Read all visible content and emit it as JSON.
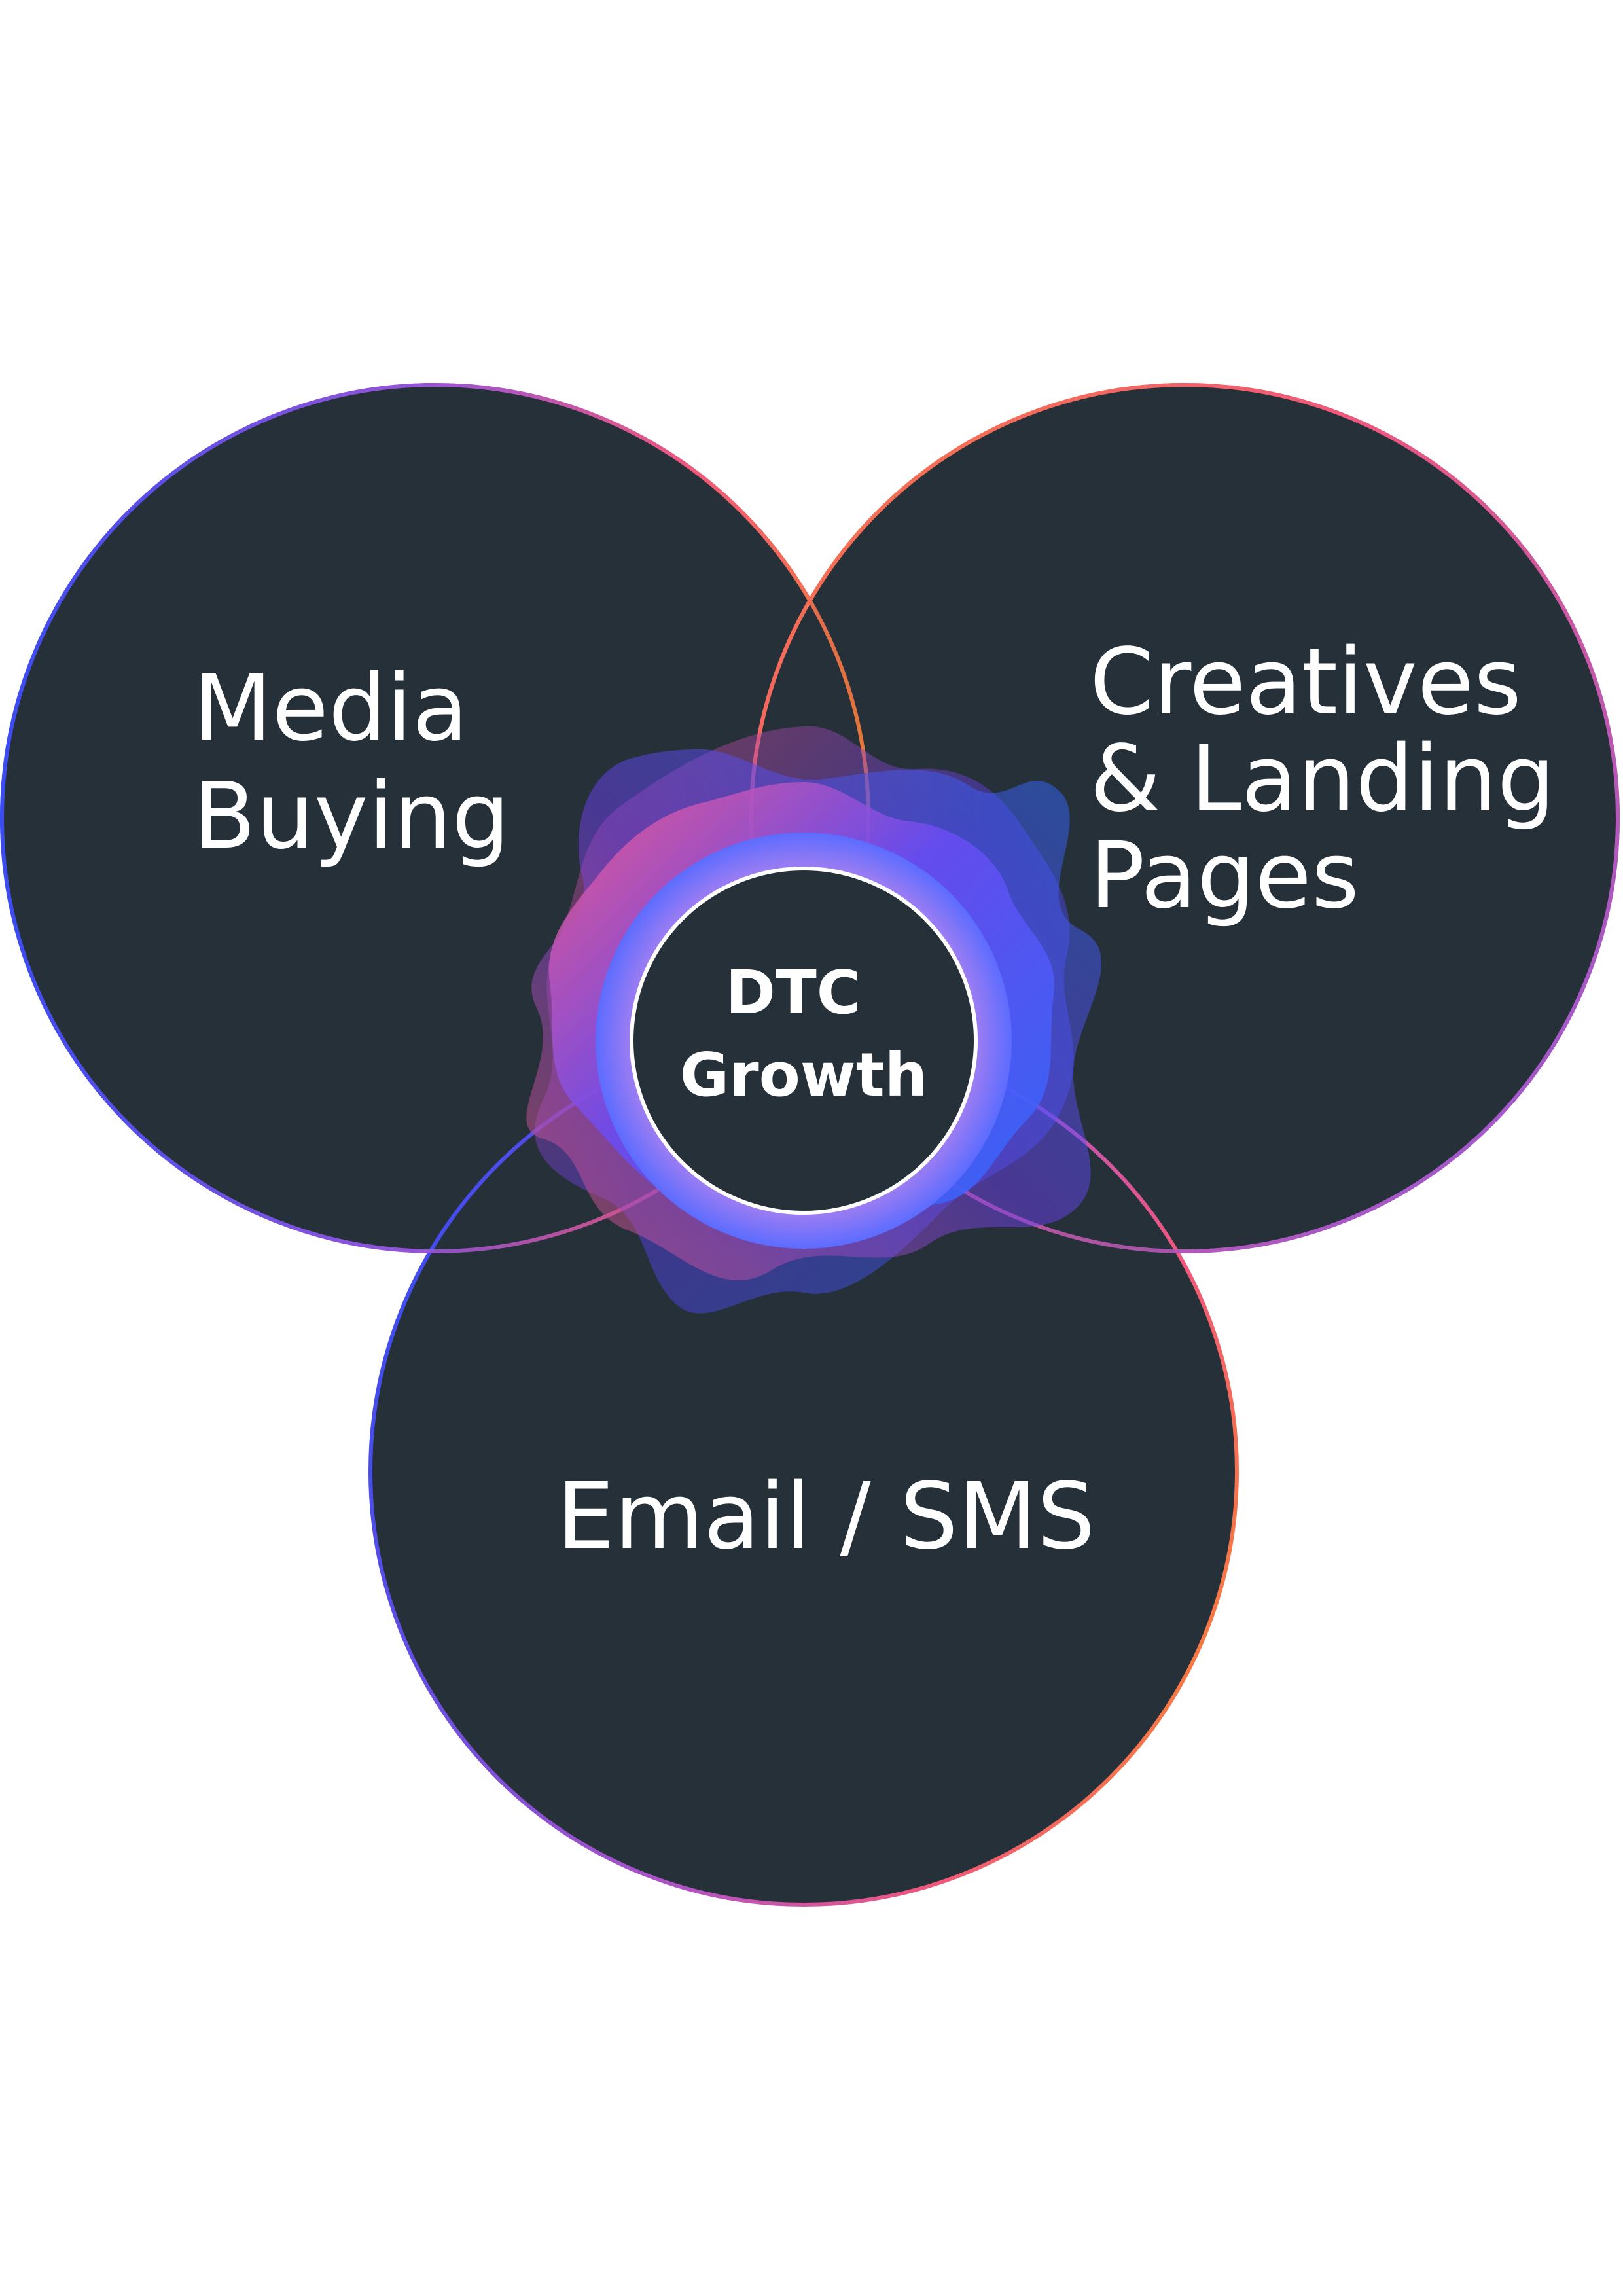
{
  "diagram": {
    "type": "venn",
    "sets": [
      {
        "id": "media",
        "lines": [
          "Media",
          "Buying"
        ]
      },
      {
        "id": "creatives",
        "lines": [
          "Creatives",
          "& Landing",
          "Pages"
        ]
      },
      {
        "id": "email",
        "lines": [
          "Email / SMS"
        ]
      }
    ],
    "center": {
      "lines": [
        "DTC",
        "Growth"
      ]
    },
    "colors": {
      "circle_fill": "#263038",
      "gradient_blue": "#3b4cf0",
      "gradient_purple": "#9a55d6",
      "gradient_pink": "#f0587a",
      "gradient_orange": "#f77f3a",
      "center_blue": "#2f66ff",
      "center_violet": "#6a3ef0",
      "center_pink": "#f05080",
      "text": "#ffffff"
    }
  }
}
